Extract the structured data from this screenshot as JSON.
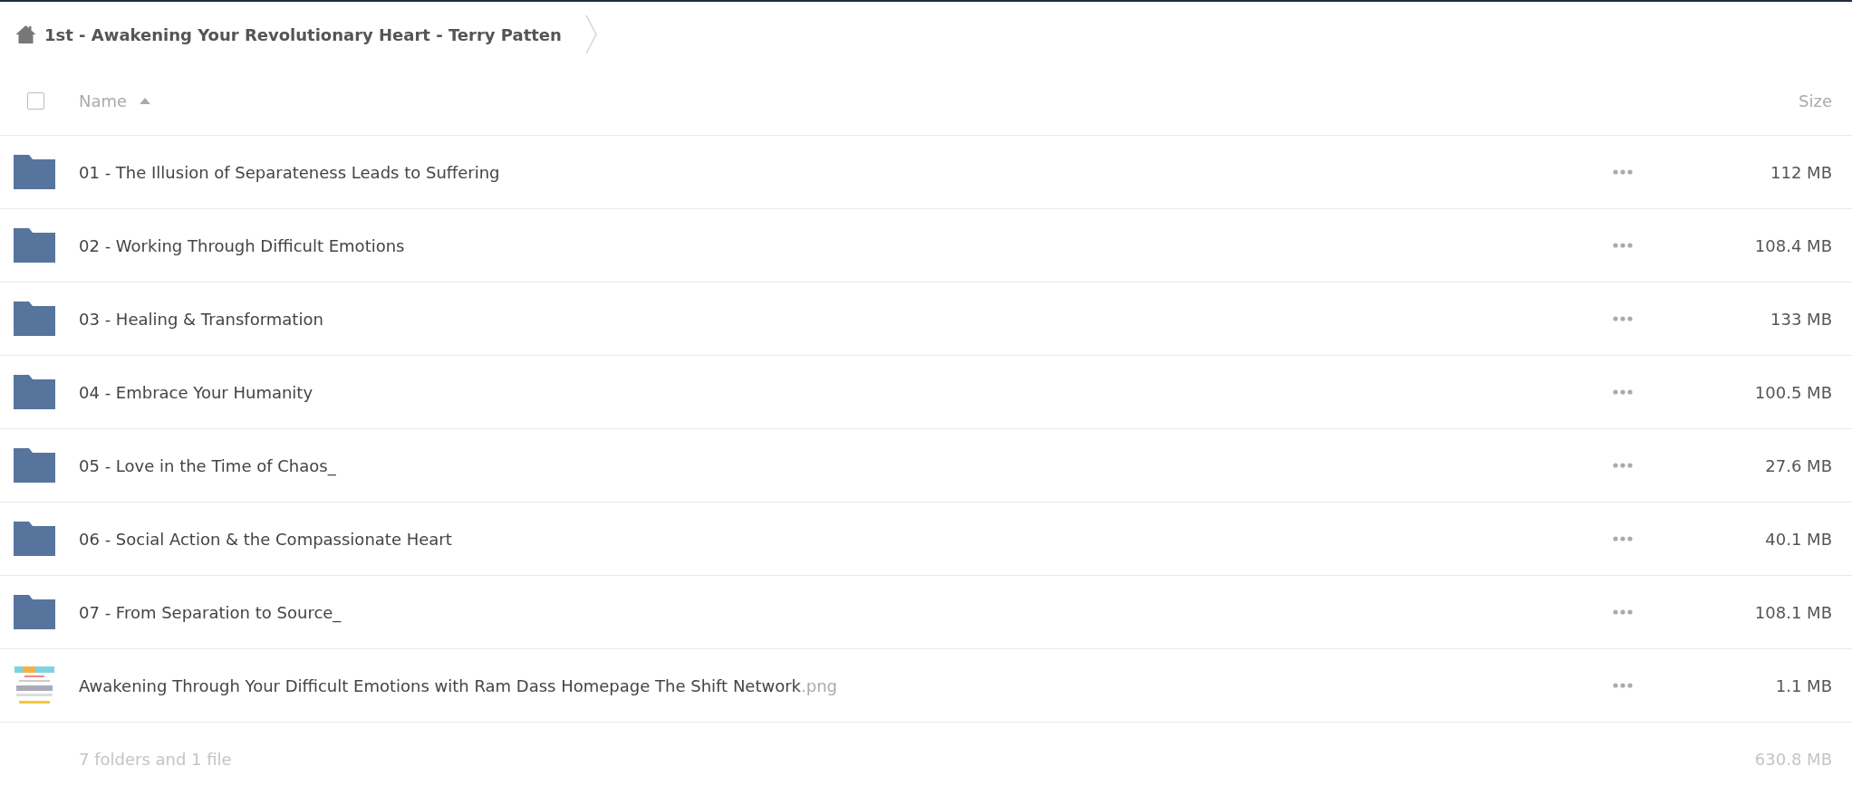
{
  "breadcrumb": {
    "title": "1st - Awakening Your Revolutionary Heart - Terry Patten"
  },
  "header": {
    "select_all_checked": false,
    "name_label": "Name",
    "size_label": "Size"
  },
  "rows": [
    {
      "kind": "folder",
      "name": "01 - The Illusion of Separateness Leads to Suffering",
      "size": "112 MB"
    },
    {
      "kind": "folder",
      "name": "02 - Working Through Difficult Emotions",
      "size": "108.4 MB"
    },
    {
      "kind": "folder",
      "name": "03 - Healing & Transformation",
      "size": "133 MB"
    },
    {
      "kind": "folder",
      "name": "04 - Embrace Your Humanity",
      "size": "100.5 MB"
    },
    {
      "kind": "folder",
      "name": "05 - Love in the Time of Chaos_",
      "size": "27.6 MB"
    },
    {
      "kind": "folder",
      "name": "06 - Social Action & the Compassionate Heart",
      "size": "40.1 MB"
    },
    {
      "kind": "folder",
      "name": "07 - From Separation to Source_",
      "size": "108.1 MB"
    },
    {
      "kind": "file",
      "name": "Awakening Through Your Difficult Emotions with Ram Dass Homepage The Shift Network",
      "extension": ".png",
      "size": "1.1 MB"
    }
  ],
  "summary": {
    "text": "7 folders and 1 file",
    "size": "630.8 MB"
  }
}
